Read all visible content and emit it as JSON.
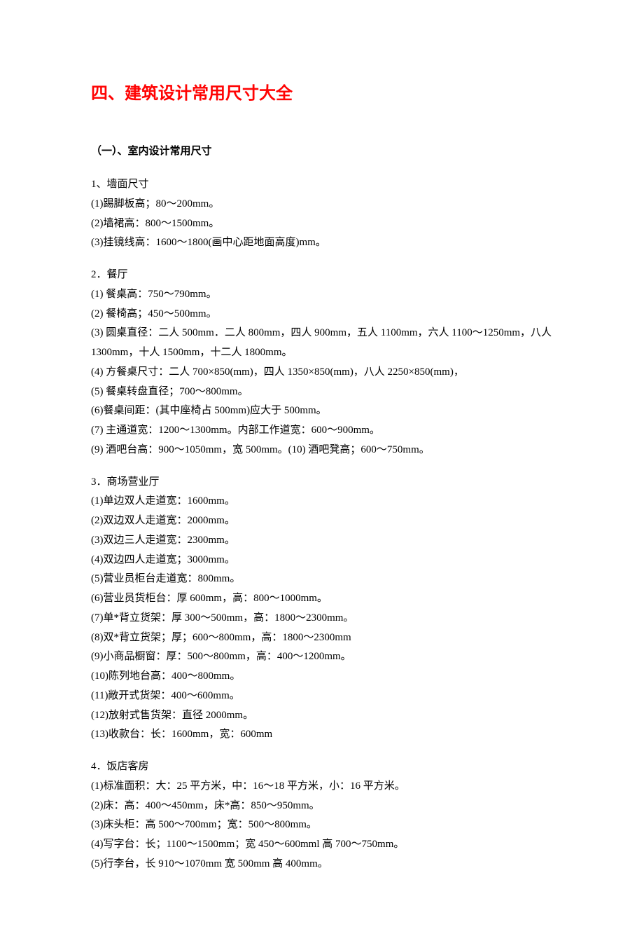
{
  "title": "四、建筑设计常用尺寸大全",
  "subtitle": "（一）、室内设计常用尺寸",
  "sections": [
    {
      "heading": "1、墙面尺寸",
      "items": [
        "(1)踢脚板高；80～200mm。",
        "(2)墙裙高：800～1500mm。",
        "(3)挂镜线高：1600～1800(画中心距地面高度)mm。"
      ]
    },
    {
      "heading": "2．餐厅",
      "items": [
        "(1) 餐桌高：750～790mm。",
        "(2) 餐椅高；450～500mm。",
        "(3) 圆桌直径：二人 500mm．二人 800mm，四人 900mm，五人 1100mm，六人 1100～1250mm，八人1300mm，十人 1500mm，十二人 1800mm。",
        "(4) 方餐桌尺寸：二人 700×850(mm)，四人 1350×850(mm)，八人 2250×850(mm)，",
        "(5) 餐桌转盘直径；700～800mm。",
        "(6)餐桌间距：(其中座椅占 500mm)应大于 500mm。",
        "(7) 主通道宽：1200～1300mm。内部工作道宽：600～900mm。",
        "(9) 酒吧台高：900～1050mm，宽 500mm。(10) 酒吧凳高；600～750mm。"
      ]
    },
    {
      "heading": "3．商场营业厅",
      "items": [
        "(1)单边双人走道宽：1600mm。",
        "(2)双边双人走道宽：2000mm。",
        "(3)双边三人走道宽：2300mm。",
        "(4)双边四人走道宽；3000mm。",
        "(5)营业员柜台走道宽：800mm。",
        "(6)营业员货柜台：厚 600mm，高：800～1000mm。",
        "(7)单*背立货架：厚 300～500mm，高：1800～2300mm。",
        "(8)双*背立货架；厚；600～800mm，高：1800～2300mm",
        "(9)小商品橱窗：厚：500～800mm，高：400～1200mm。",
        "(10)陈列地台高：400～800mm。",
        "(11)敞开式货架：400～600mm。",
        "(12)放射式售货架：直径 2000mm。",
        "(13)收款台：长：1600mm，宽：600mm"
      ]
    },
    {
      "heading": "4．饭店客房",
      "items": [
        "(1)标准面积：大：25 平方米，中：16～18 平方米，小：16 平方米。",
        "(2)床：高：400～450mm，床*高：850～950mm。",
        "(3)床头柜：高 500～700mm；宽：500～800mm。",
        "(4)写字台：长；1100～1500mm；宽 450～600mml 高 700～750mm。",
        "(5)行李台，长 910～1070mm 宽 500mm 高 400mm。"
      ]
    }
  ]
}
